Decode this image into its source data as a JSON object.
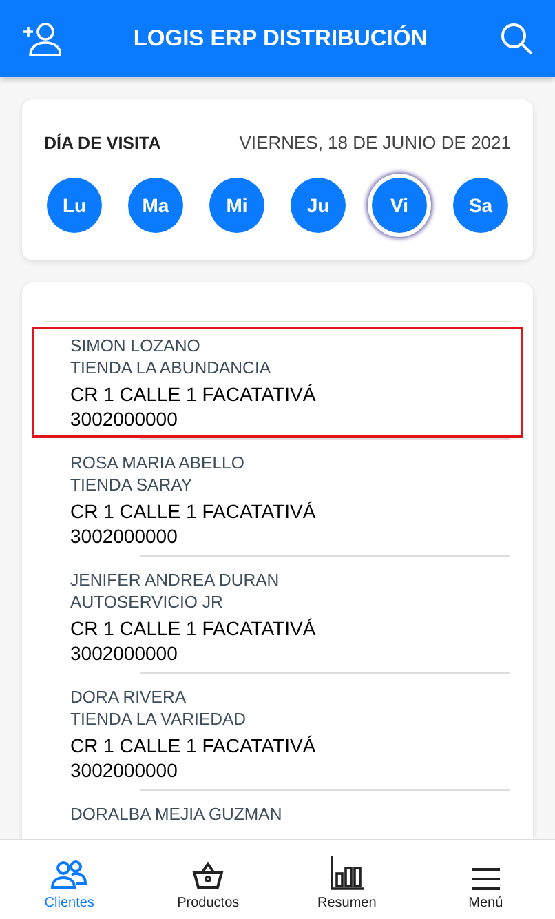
{
  "header": {
    "title": "LOGIS ERP DISTRIBUCIÓN"
  },
  "visit": {
    "label": "DÍA DE VISITA",
    "date": "VIERNES, 18 DE JUNIO DE 2021",
    "days": [
      {
        "label": "Lu",
        "selected": false
      },
      {
        "label": "Ma",
        "selected": false
      },
      {
        "label": "Mi",
        "selected": false
      },
      {
        "label": "Ju",
        "selected": false
      },
      {
        "label": "Vi",
        "selected": true
      },
      {
        "label": "Sa",
        "selected": false
      }
    ]
  },
  "clients": [
    {
      "name": "SIMON LOZANO",
      "store": "TIENDA LA ABUNDANCIA",
      "address": "CR 1 CALLE 1 FACATATIVÁ",
      "phone": "3002000000",
      "selected": true
    },
    {
      "name": "ROSA MARIA ABELLO",
      "store": "TIENDA SARAY",
      "address": "CR 1 CALLE 1 FACATATIVÁ",
      "phone": "3002000000",
      "selected": false
    },
    {
      "name": "JENIFER ANDREA DURAN",
      "store": "AUTOSERVICIO JR",
      "address": "CR 1 CALLE 1 FACATATIVÁ",
      "phone": "3002000000",
      "selected": false
    },
    {
      "name": "DORA RIVERA",
      "store": "TIENDA LA VARIEDAD",
      "address": "CR 1 CALLE 1 FACATATIVÁ",
      "phone": "3002000000",
      "selected": false
    },
    {
      "name": "DORALBA MEJIA GUZMAN",
      "selected": false
    }
  ],
  "tabs": [
    {
      "label": "Clientes",
      "kind": "clients",
      "selected": true
    },
    {
      "label": "Productos",
      "kind": "basket",
      "selected": false
    },
    {
      "label": "Resumen",
      "kind": "chart",
      "selected": false
    },
    {
      "label": "Menú",
      "kind": "menu",
      "selected": false
    }
  ]
}
